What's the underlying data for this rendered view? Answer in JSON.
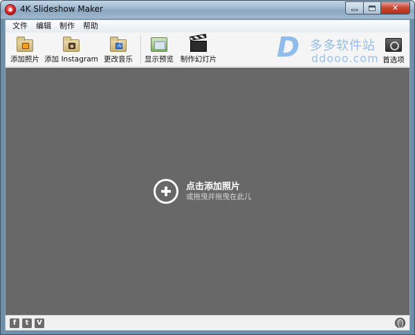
{
  "window": {
    "title": "4K Slideshow Maker"
  },
  "menu": {
    "items": [
      "文件",
      "编辑",
      "制作",
      "帮助"
    ]
  },
  "toolbar": {
    "add_photos_label": "添加照片",
    "add_instagram_label": "添加 Instagram",
    "change_music_label": "更改音乐",
    "show_preview_label": "显示预览",
    "make_slideshow_label": "制作幻灯片",
    "preferences_label": "首选项"
  },
  "watermark": {
    "site_name": "多多软件站",
    "url": "ddooo.com"
  },
  "drop_area": {
    "title": "点击添加照片",
    "subtitle": "或拖曳并拖曳在此儿"
  },
  "footer": {
    "facebook": "f",
    "twitter": "t",
    "vimeo": "V"
  },
  "colors": {
    "drop_area_bg": "#686868",
    "toolbar_bg": "#f5f5f5",
    "watermark_blue": "#3d8fe0"
  }
}
